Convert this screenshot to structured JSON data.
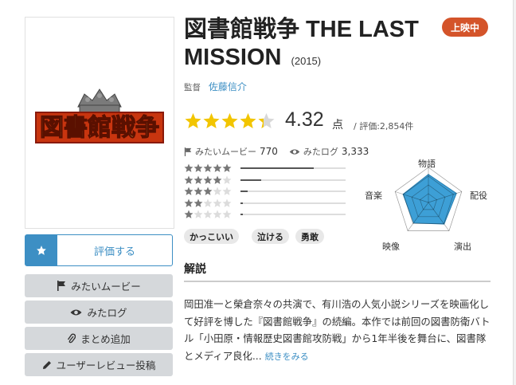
{
  "movie": {
    "title": "図書館戦争 THE LAST MISSION",
    "year": "(2015)",
    "status_badge": "上映中",
    "poster_logo": "図書館戦争",
    "director_role": "監督",
    "director_name": "佐藤信介"
  },
  "score": {
    "value": "4.32",
    "unit": "点",
    "count_text": "/ 評価:2,854件",
    "stars_filled": 4.32,
    "star_color": "#f2c500"
  },
  "counts": {
    "want_label": "みたいムービー",
    "want_count": "770",
    "watched_label": "みたログ",
    "watched_count": "3,333"
  },
  "rating_distribution": [
    {
      "stars": 5,
      "fraction": 0.7
    },
    {
      "stars": 4,
      "fraction": 0.2
    },
    {
      "stars": 3,
      "fraction": 0.07
    },
    {
      "stars": 2,
      "fraction": 0.02
    },
    {
      "stars": 1,
      "fraction": 0.02
    }
  ],
  "tags": [
    "かっこいい",
    "泣ける",
    "勇敢"
  ],
  "radar": {
    "labels": [
      "物語",
      "配役",
      "演出",
      "映像",
      "音楽"
    ],
    "values": [
      0.8,
      0.84,
      0.76,
      0.72,
      0.76
    ],
    "fill_color": "#3d9fd6"
  },
  "buttons": {
    "rate": "評価する",
    "want": "みたいムービー",
    "watched": "みたログ",
    "add_collection": "まとめ追加",
    "post_review": "ユーザーレビュー投稿"
  },
  "explanation": {
    "heading": "解説",
    "text": "岡田准一と榮倉奈々の共演で、有川浩の人気小説シリーズを映画化して好評を博した『図書館戦争』の続編。本作では前回の図書防衛バトル「小田原・情報歴史図書館攻防戦」から1年半後を舞台に、図書隊とメディア良化...",
    "more": "続きをみる"
  }
}
